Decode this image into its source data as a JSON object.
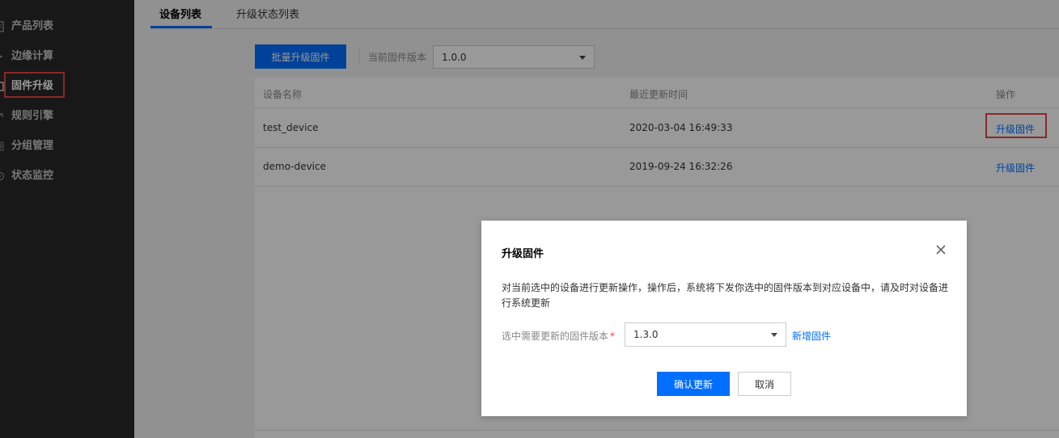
{
  "sidebar": {
    "items": [
      {
        "label": "产品列表",
        "icon": "list-icon"
      },
      {
        "label": "边缘计算",
        "icon": "edge-icon"
      },
      {
        "label": "固件升级",
        "icon": "firmware-icon"
      },
      {
        "label": "规则引擎",
        "icon": "rule-icon"
      },
      {
        "label": "分组管理",
        "icon": "group-icon"
      },
      {
        "label": "状态监控",
        "icon": "monitor-icon"
      }
    ]
  },
  "tabs": [
    {
      "label": "设备列表"
    },
    {
      "label": "升级状态列表"
    }
  ],
  "toolbar": {
    "batch_upgrade_label": "批量升级固件",
    "current_version_label": "当前固件版本",
    "current_version_value": "1.0.0"
  },
  "table": {
    "headers": {
      "name": "设备名称",
      "time": "最近更新时间",
      "action": "操作"
    },
    "rows": [
      {
        "name": "test_device",
        "time": "2020-03-04 16:49:33",
        "action": "升级固件"
      },
      {
        "name": "demo-device",
        "time": "2019-09-24 16:32:26",
        "action": "升级固件"
      }
    ]
  },
  "dialog": {
    "title": "升级固件",
    "description": "对当前选中的设备进行更新操作，操作后，系统将下发你选中的固件版本到对应设备中，请及时对设备进行系统更新",
    "version_label": "选中需要更新的固件版本",
    "required_mark": "*",
    "version_value": "1.3.0",
    "add_firmware_link": "新增固件",
    "confirm_label": "确认更新",
    "cancel_label": "取消"
  },
  "colors": {
    "accent": "#006eff",
    "highlight": "#e54545",
    "sidebar_bg": "#292929"
  }
}
